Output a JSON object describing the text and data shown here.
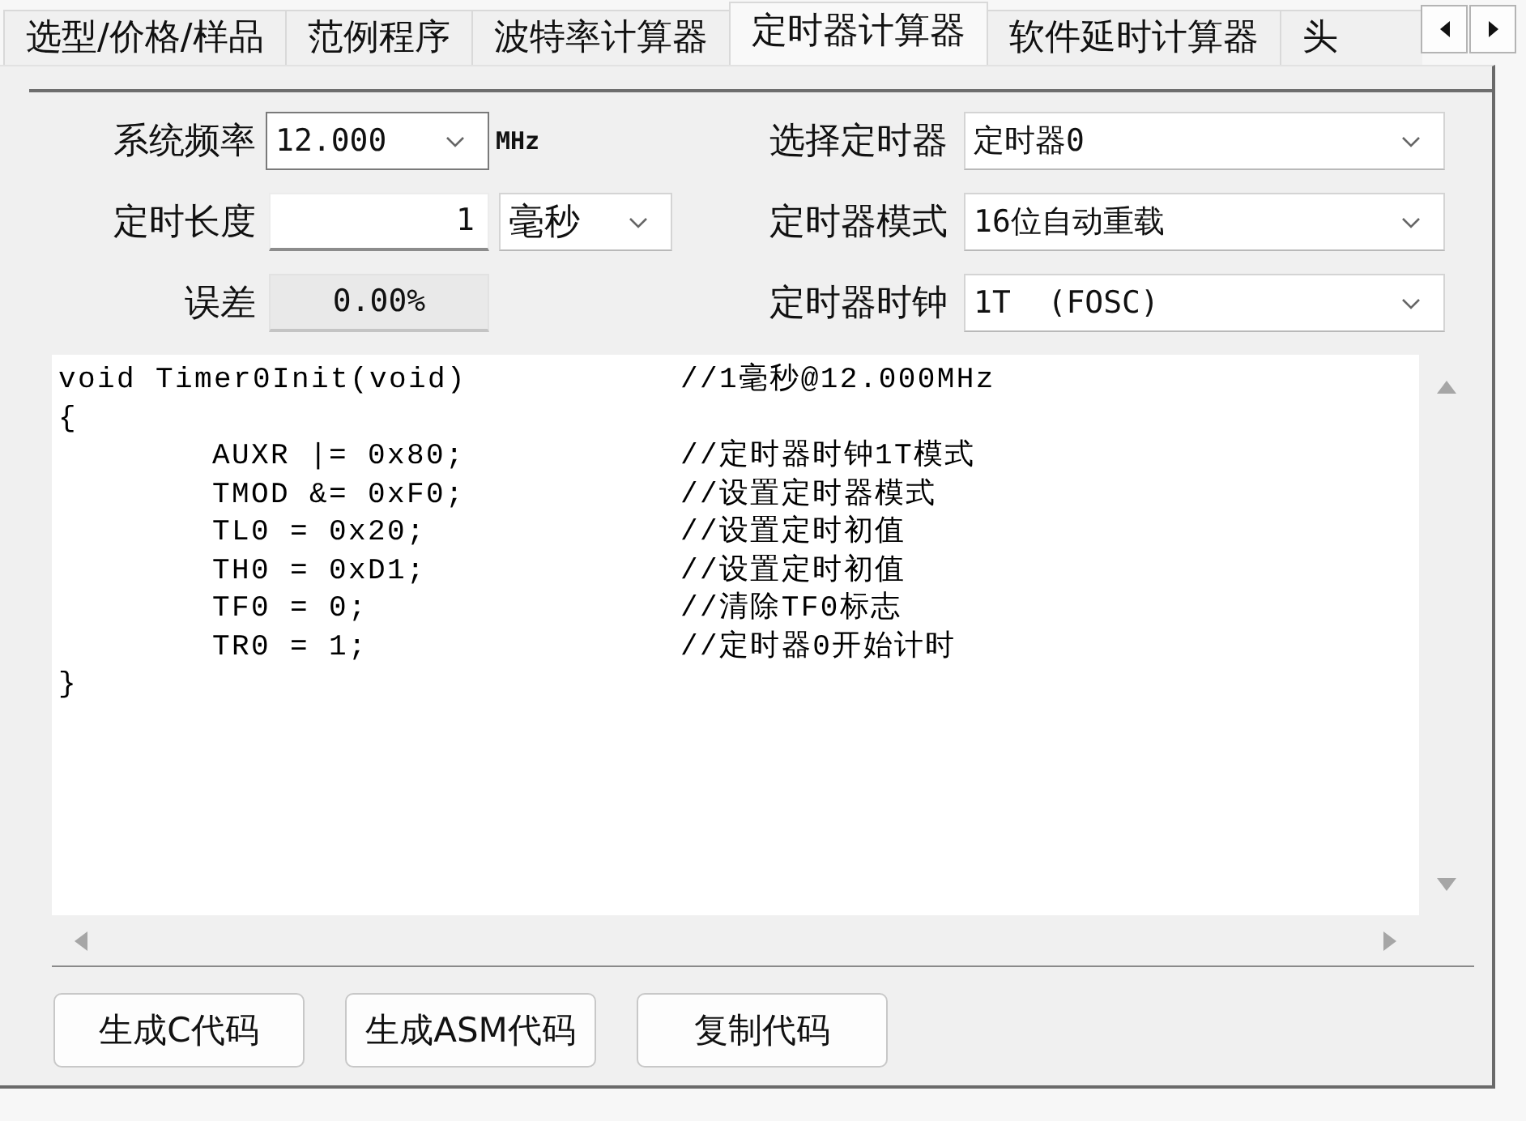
{
  "tabs": [
    {
      "label": "选型/价格/样品",
      "selected": false
    },
    {
      "label": "范例程序",
      "selected": false
    },
    {
      "label": "波特率计算器",
      "selected": false
    },
    {
      "label": "定时器计算器",
      "selected": true
    },
    {
      "label": "软件延时计算器",
      "selected": false
    },
    {
      "label": "头",
      "selected": false
    }
  ],
  "form": {
    "left": [
      {
        "kind": "select",
        "label": "系统频率",
        "value": "12.000",
        "focused": true,
        "unit": "MHz"
      },
      {
        "kind": "input",
        "label": "定时长度",
        "value": "1",
        "focused": false,
        "unit_select": "毫秒"
      },
      {
        "kind": "readonly",
        "label": "误差",
        "value": "0.00%",
        "focused": false
      }
    ],
    "right": [
      {
        "label": "选择定时器",
        "value": "定时器0",
        "focused": false
      },
      {
        "label": "定时器模式",
        "value": "16位自动重载",
        "focused": false
      },
      {
        "label": "定时器时钟",
        "value": "1T  (FOSC)",
        "focused": false
      }
    ]
  },
  "code": {
    "signature": "void Timer0Init(void)",
    "signature_comment": "//1毫秒@12.000MHz",
    "open": "{",
    "body": [
      {
        "code": "AUXR |= 0x80;",
        "comment": "//定时器时钟1T模式"
      },
      {
        "code": "TMOD &= 0xF0;",
        "comment": "//设置定时器模式"
      },
      {
        "code": "TL0 = 0x20;",
        "comment": "//设置定时初值"
      },
      {
        "code": "TH0 = 0xD1;",
        "comment": "//设置定时初值"
      },
      {
        "code": "TF0 = 0;",
        "comment": "//清除TF0标志"
      },
      {
        "code": "TR0 = 1;",
        "comment": "//定时器0开始计时"
      }
    ],
    "close": "}"
  },
  "buttons": [
    "生成C代码",
    "生成ASM代码",
    "复制代码"
  ]
}
